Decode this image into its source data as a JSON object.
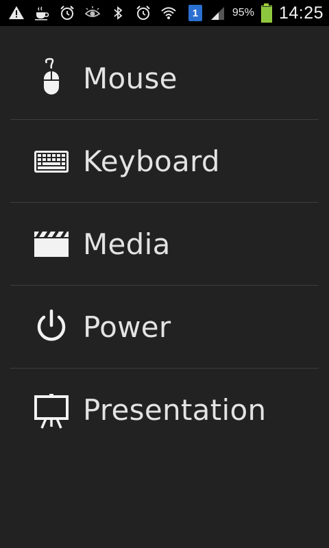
{
  "status_bar": {
    "icons": [
      "warning-icon",
      "coffee-icon",
      "alarm-snooze-icon",
      "eye-icon",
      "bluetooth-icon",
      "alarm-clock-icon",
      "wifi-icon"
    ],
    "notification_count": "1",
    "battery_percent_label": "95%",
    "battery_level": 0.95,
    "time": "14:25",
    "battery_color": "#8cc63f"
  },
  "menu": {
    "items": [
      {
        "label": "Mouse",
        "icon": "mouse-icon"
      },
      {
        "label": "Keyboard",
        "icon": "keyboard-icon"
      },
      {
        "label": "Media",
        "icon": "clapperboard-icon"
      },
      {
        "label": "Power",
        "icon": "power-icon"
      },
      {
        "label": "Presentation",
        "icon": "presentation-board-icon"
      }
    ]
  },
  "colors": {
    "background": "#222222",
    "status_bar": "#000000",
    "divider": "#3d3d3d",
    "text": "#e3e3e3"
  }
}
